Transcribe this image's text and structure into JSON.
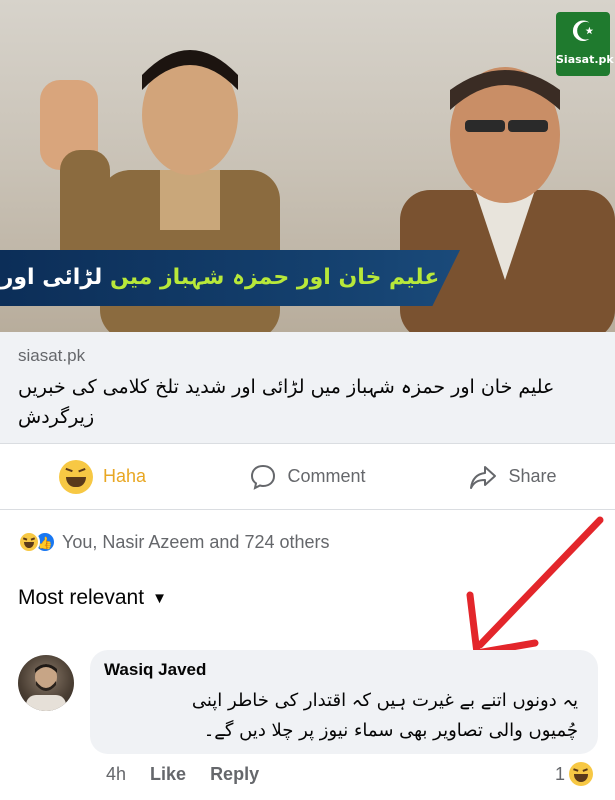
{
  "post": {
    "preview": {
      "logo_text": "Siasat.pk",
      "banner_text_highlight": "علیم خان اور حمزہ شہباز میں",
      "banner_text_rest": " لڑائی اور شدید تلخ کلامی کی خبریں زیر گردش"
    },
    "source_domain": "siasat.pk",
    "headline": "علیم خان اور حمزہ شہباز میں لڑائی اور شدید تلخ کلامی کی خبریں زیرگردش"
  },
  "actions": {
    "haha_label": "Haha",
    "comment_label": "Comment",
    "share_label": "Share"
  },
  "reactions": {
    "summary": "You, Nasir Azeem and 724 others"
  },
  "comments_sort": {
    "label": "Most relevant"
  },
  "comment": {
    "author": "Wasiq Javed",
    "text_line1": "یہ دونوں اتنے بے غیرت ہیں کہ اقتدار کی خاطر اپنی",
    "text_line2": "چُمیوں والی تصاویر بھی سماء نیوز پر چلا دیں گے۔",
    "time": "4h",
    "like_label": "Like",
    "reply_label": "Reply",
    "reaction_count": "1"
  },
  "colors": {
    "haha_accent": "#e8a723",
    "annotation_arrow": "#e3262b",
    "like_blue": "#1877f2"
  }
}
